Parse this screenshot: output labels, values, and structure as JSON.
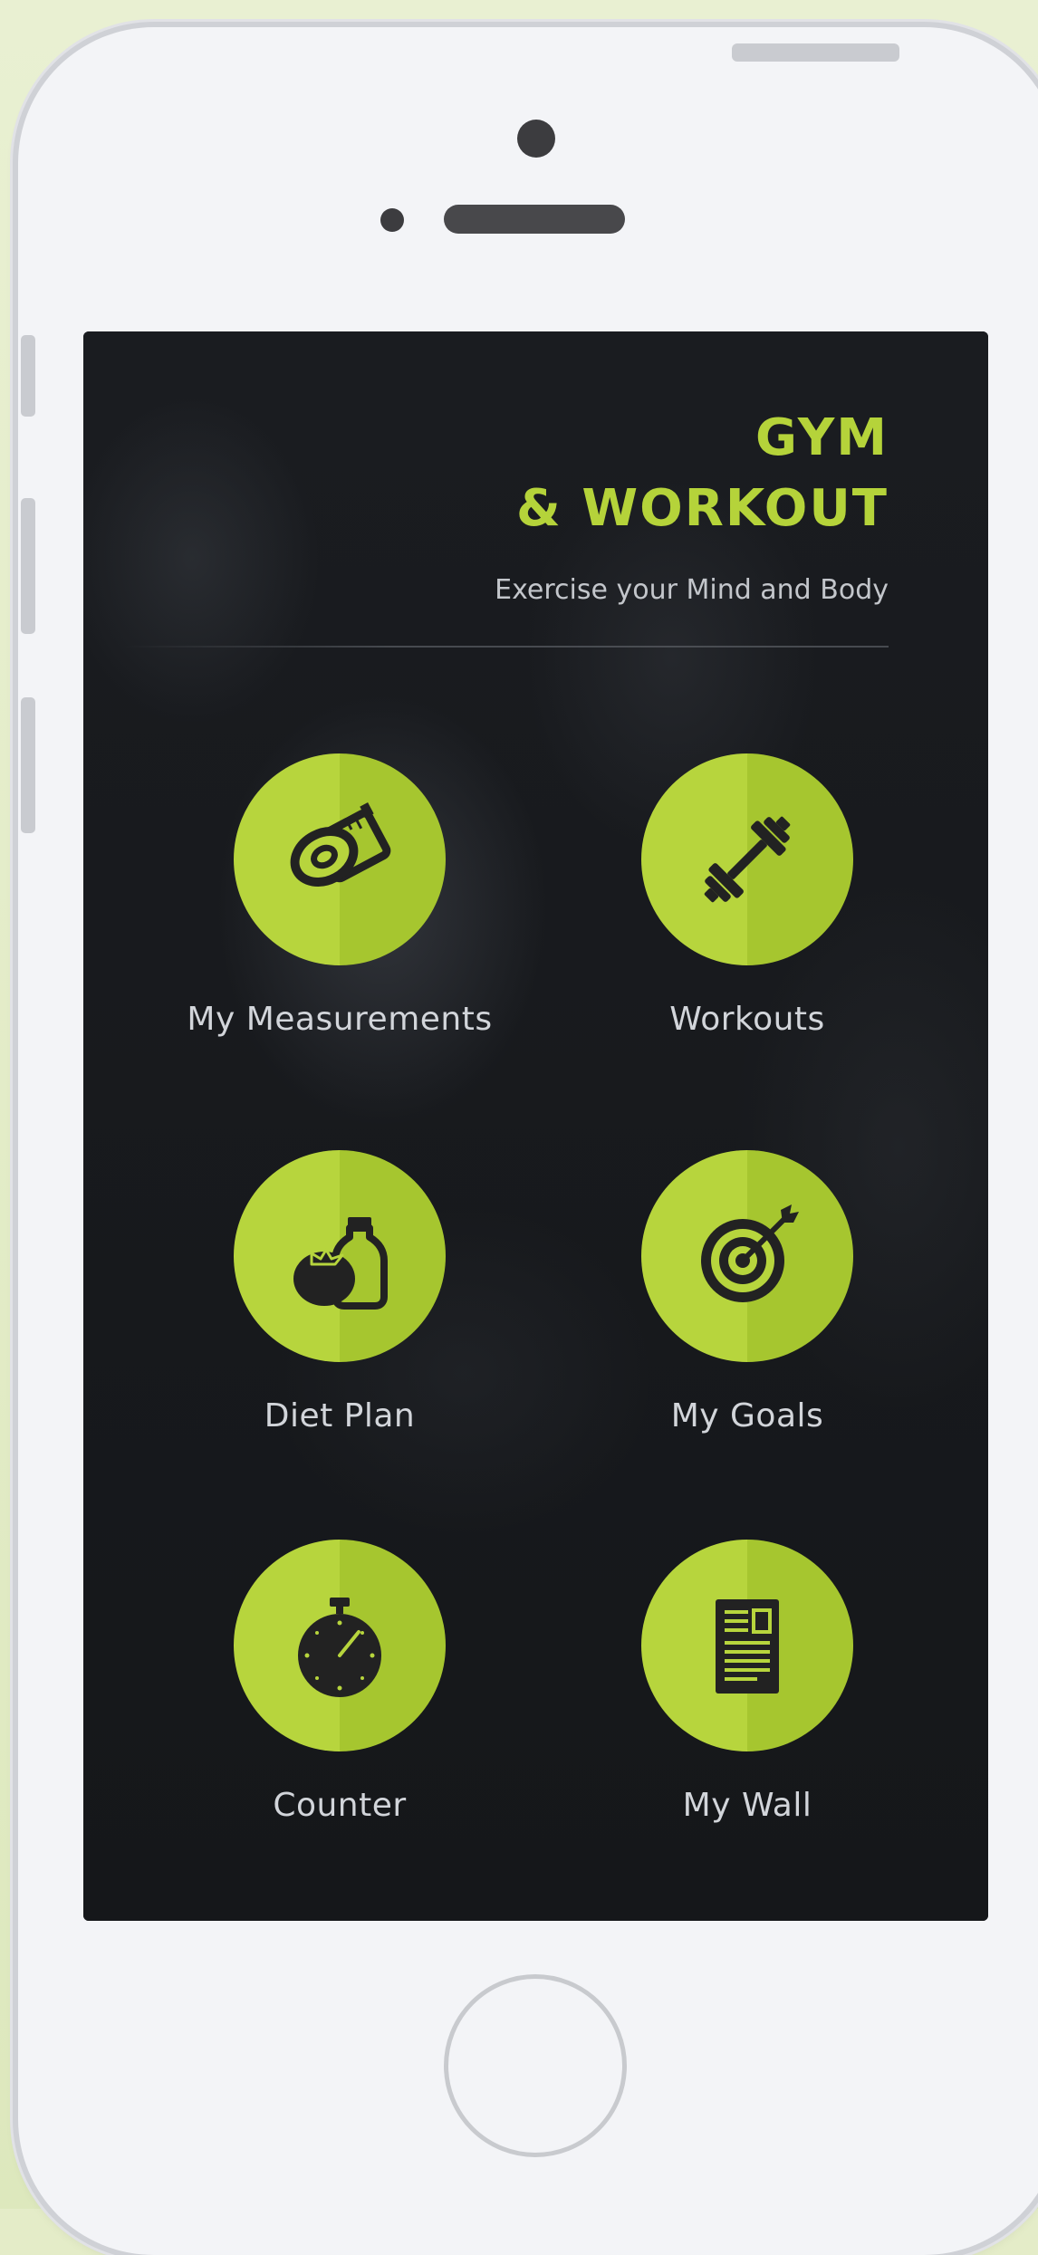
{
  "app": {
    "title_line1": "GYM",
    "title_line2": "& WORKOUT",
    "subtitle": "Exercise your Mind and Body",
    "accent_color": "#b5d33a",
    "screen_color": "#17191d"
  },
  "menu": {
    "items": [
      {
        "label": "My Measurements",
        "icon": "measuring-tape-icon"
      },
      {
        "label": "Workouts",
        "icon": "dumbbell-icon"
      },
      {
        "label": "Diet Plan",
        "icon": "tomato-and-bottle-icon"
      },
      {
        "label": "My Goals",
        "icon": "target-icon"
      },
      {
        "label": "Counter",
        "icon": "stopwatch-icon"
      },
      {
        "label": "My Wall",
        "icon": "document-icon"
      }
    ]
  }
}
